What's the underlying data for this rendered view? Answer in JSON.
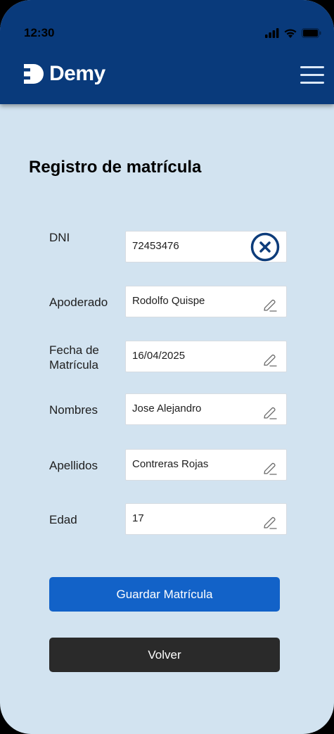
{
  "status_bar": {
    "time": "12:30"
  },
  "header": {
    "logo_text": "Demy"
  },
  "page": {
    "title": "Registro de matrícula"
  },
  "form": {
    "fields": [
      {
        "label": "DNI",
        "value": "72453476",
        "icon": "clear-icon"
      },
      {
        "label": "Apoderado",
        "value": "Rodolfo Quispe",
        "icon": "pencil-icon"
      },
      {
        "label": "Fecha de Matrícula",
        "value": "16/04/2025",
        "icon": "pencil-icon"
      },
      {
        "label": "Nombres",
        "value": "Jose Alejandro",
        "icon": "pencil-icon"
      },
      {
        "label": "Apellidos",
        "value": "Contreras Rojas",
        "icon": "pencil-icon"
      },
      {
        "label": "Edad",
        "value": "17",
        "icon": "pencil-icon"
      }
    ]
  },
  "buttons": {
    "save": "Guardar Matrícula",
    "back": "Volver"
  },
  "colors": {
    "header": "#093a7b",
    "background": "#d2e3f0",
    "primary": "#1262c8",
    "dark": "#2a2a2a"
  }
}
